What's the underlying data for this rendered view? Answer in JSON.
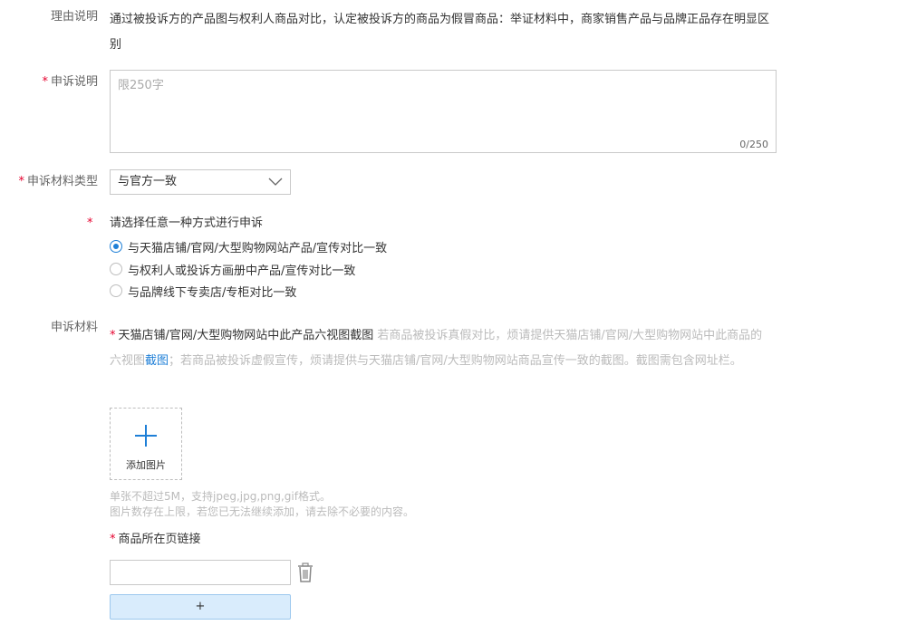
{
  "reason": {
    "label": "理由说明",
    "text": "通过被投诉方的产品图与权利人商品对比，认定被投诉方的商品为假冒商品：举证材料中，商家销售产品与品牌正品存在明显区别"
  },
  "appeal_desc": {
    "required_mark": "*",
    "label": "申诉说明",
    "placeholder": "限250字",
    "value": "",
    "counter": "0/250"
  },
  "material_type": {
    "required_mark": "*",
    "label": "申诉材料类型",
    "selected": "与官方一致",
    "chevron_icon": "chevron-down-icon"
  },
  "method": {
    "required_mark": "*",
    "title": "请选择任意一种方式进行申诉",
    "options": [
      {
        "label": "与天猫店铺/官网/大型购物网站产品/宣传对比一致",
        "checked": true
      },
      {
        "label": "与权利人或投诉方画册中产品/宣传对比一致",
        "checked": false
      },
      {
        "label": "与品牌线下专卖店/专柜对比一致",
        "checked": false
      }
    ]
  },
  "materials": {
    "label": "申诉材料",
    "required_mark": "*",
    "item_title": "天猫店铺/官网/大型购物网站中此产品六视图截图",
    "desc_part1": " 若商品被投诉真假对比，烦请提供天猫店铺/官网/大型购物网站中此商品的六视图",
    "desc_link": "截图",
    "desc_part2": "；若商品被投诉虚假宣传，烦请提供与天猫店铺/官网/大型购物网站商品宣传一致的截图。截图需包含网址栏。",
    "upload_label": "添加图片",
    "hint1": "单张不超过5M，支持jpeg,jpg,png,gif格式。",
    "hint2": "图片数存在上限，若您已无法继续添加，请去除不必要的内容。"
  },
  "product_link": {
    "required_mark": "*",
    "label": "商品所在页链接",
    "value": "",
    "add_label": "+"
  },
  "colors": {
    "required": "#e5002d",
    "accent": "#1e7fd7",
    "add_button_bg": "#d9ecfc"
  }
}
